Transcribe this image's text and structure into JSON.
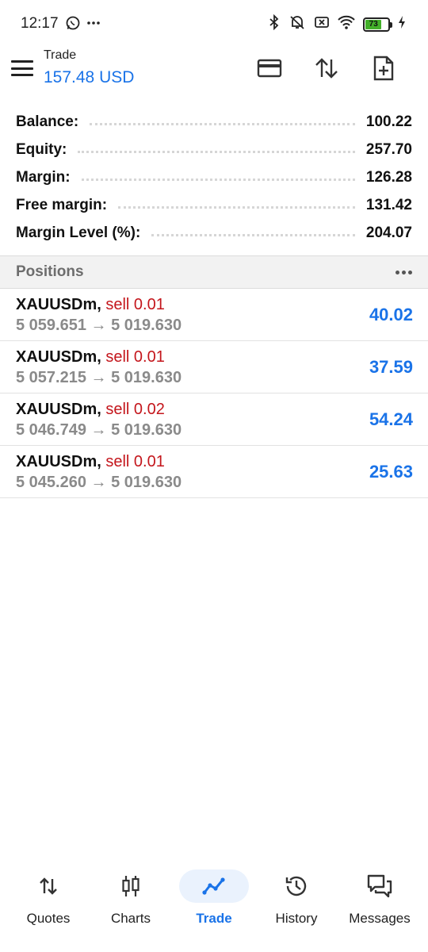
{
  "status_bar": {
    "time": "12:17",
    "battery_level": "73",
    "icons": [
      "whatsapp-icon",
      "more-dots-icon",
      "bluetooth-icon",
      "vibrate-off-icon",
      "no-sim-icon",
      "wifi-icon",
      "battery-icon",
      "charging-icon"
    ]
  },
  "header": {
    "title": "Trade",
    "balance": "157.48 USD",
    "actions": [
      "deposit-card-icon",
      "sort-icon",
      "new-order-icon"
    ]
  },
  "summary": [
    {
      "label": "Balance:",
      "value": "100.22"
    },
    {
      "label": "Equity:",
      "value": "257.70"
    },
    {
      "label": "Margin:",
      "value": "126.28"
    },
    {
      "label": "Free margin:",
      "value": "131.42"
    },
    {
      "label": "Margin Level (%):",
      "value": "204.07"
    }
  ],
  "positions": {
    "title": "Positions",
    "items": [
      {
        "symbol": "XAUUSDm,",
        "type": "sell 0.01",
        "prices": "5 059.651 → 5 019.630",
        "profit": "40.02"
      },
      {
        "symbol": "XAUUSDm,",
        "type": "sell 0.01",
        "prices": "5 057.215 → 5 019.630",
        "profit": "37.59"
      },
      {
        "symbol": "XAUUSDm,",
        "type": "sell 0.02",
        "prices": "5 046.749 → 5 019.630",
        "profit": "54.24"
      },
      {
        "symbol": "XAUUSDm,",
        "type": "sell 0.01",
        "prices": "5 045.260 → 5 019.630",
        "profit": "25.63"
      }
    ]
  },
  "nav": [
    {
      "label": "Quotes",
      "icon": "quotes-icon",
      "active": false
    },
    {
      "label": "Charts",
      "icon": "charts-icon",
      "active": false
    },
    {
      "label": "Trade",
      "icon": "trade-icon",
      "active": true
    },
    {
      "label": "History",
      "icon": "history-icon",
      "active": false
    },
    {
      "label": "Messages",
      "icon": "messages-icon",
      "active": false
    }
  ],
  "colors": {
    "accent": "#1a73e8",
    "sell": "#c4161c",
    "muted": "#8a8a8a",
    "battery": "#43b02a"
  }
}
